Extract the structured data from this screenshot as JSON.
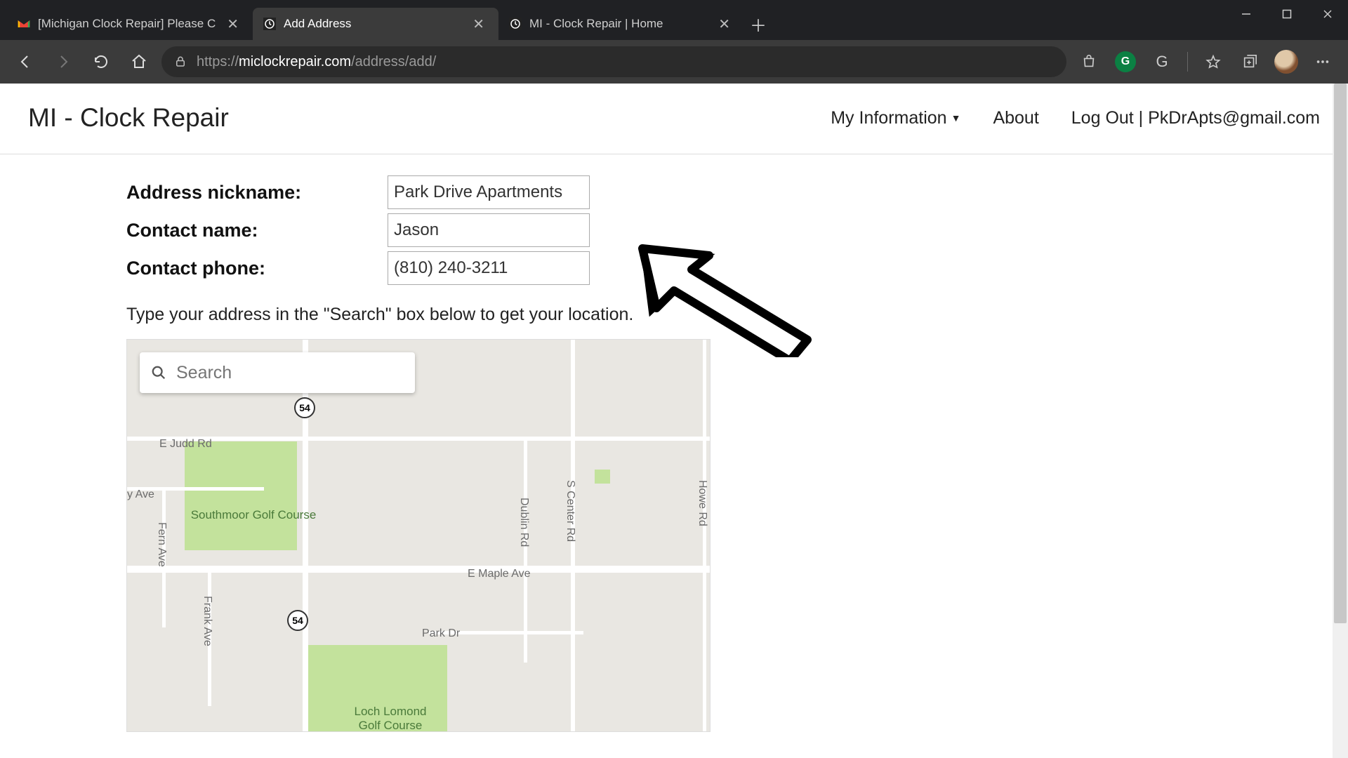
{
  "browser": {
    "tabs": [
      {
        "title": "[Michigan Clock Repair] Please C",
        "active": false,
        "favicon": "gmail"
      },
      {
        "title": "Add Address",
        "active": true,
        "favicon": "clock"
      },
      {
        "title": "MI - Clock Repair | Home",
        "active": false,
        "favicon": "clock"
      }
    ],
    "url_proto": "https://",
    "url_host": "miclockrepair.com",
    "url_path": "/address/add/"
  },
  "header": {
    "brand": "MI - Clock Repair",
    "nav": {
      "my_info": "My Information",
      "about": "About",
      "logout_prefix": "Log Out | ",
      "email": "PkDrApts@gmail.com"
    }
  },
  "form": {
    "nickname_label": "Address nickname:",
    "nickname_value": "Park Drive Apartments",
    "contact_name_label": "Contact name:",
    "contact_name_value": "Jason",
    "contact_phone_label": "Contact phone:",
    "contact_phone_value": "(810) 240-3211",
    "instruction": "Type your address in the \"Search\" box below to get your location."
  },
  "map": {
    "search_placeholder": "Search",
    "route_badge": "54",
    "labels": {
      "judd": "E Judd Rd",
      "yave": "y Ave",
      "southmoor": "Southmoor Golf Course",
      "fern": "Fern Ave",
      "frank": "Frank Ave",
      "dublin": "Dublin Rd",
      "scenter": "S Center Rd",
      "howe": "Howe Rd",
      "maple": "E Maple Ave",
      "parkdr": "Park Dr",
      "loch": "Loch Lomond\nGolf Course"
    }
  }
}
